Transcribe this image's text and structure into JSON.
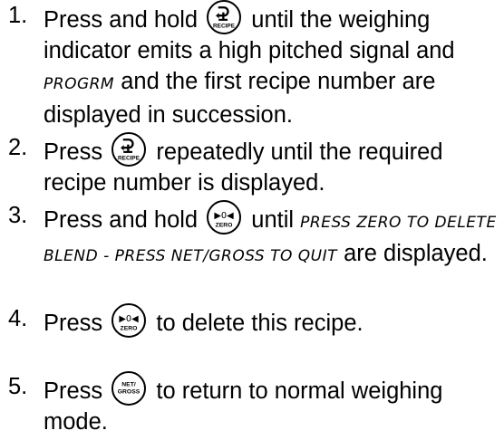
{
  "steps": [
    {
      "number": "1.",
      "text_a": "Press and hold",
      "key_label": "RECIPE",
      "text_b": "until the weighing indicator emits a high pitched signal and",
      "display_1": "PROGRM",
      "text_c": "and the first recipe number are displayed in succession."
    },
    {
      "number": "2.",
      "text_a": "Press",
      "key_label": "RECIPE",
      "text_b": "repeatedly until the required recipe number is displayed."
    },
    {
      "number": "3.",
      "text_a": "Press and hold",
      "key_symbol": "▶0◀",
      "key_label": "ZERO",
      "text_b": "until",
      "display_1": "PRESS ZERO TO DELETE BLEND - PRESS NET/GROSS TO QUIT",
      "text_c": "are displayed."
    },
    {
      "number": "4.",
      "text_a": "Press",
      "key_symbol": "▶0◀",
      "key_label": "ZERO",
      "text_b": "to delete this recipe."
    },
    {
      "number": "5.",
      "text_a": "Press",
      "key_label_top": "NET/",
      "key_label_bottom": "GROSS",
      "text_b": "to return to normal weighing mode."
    }
  ]
}
